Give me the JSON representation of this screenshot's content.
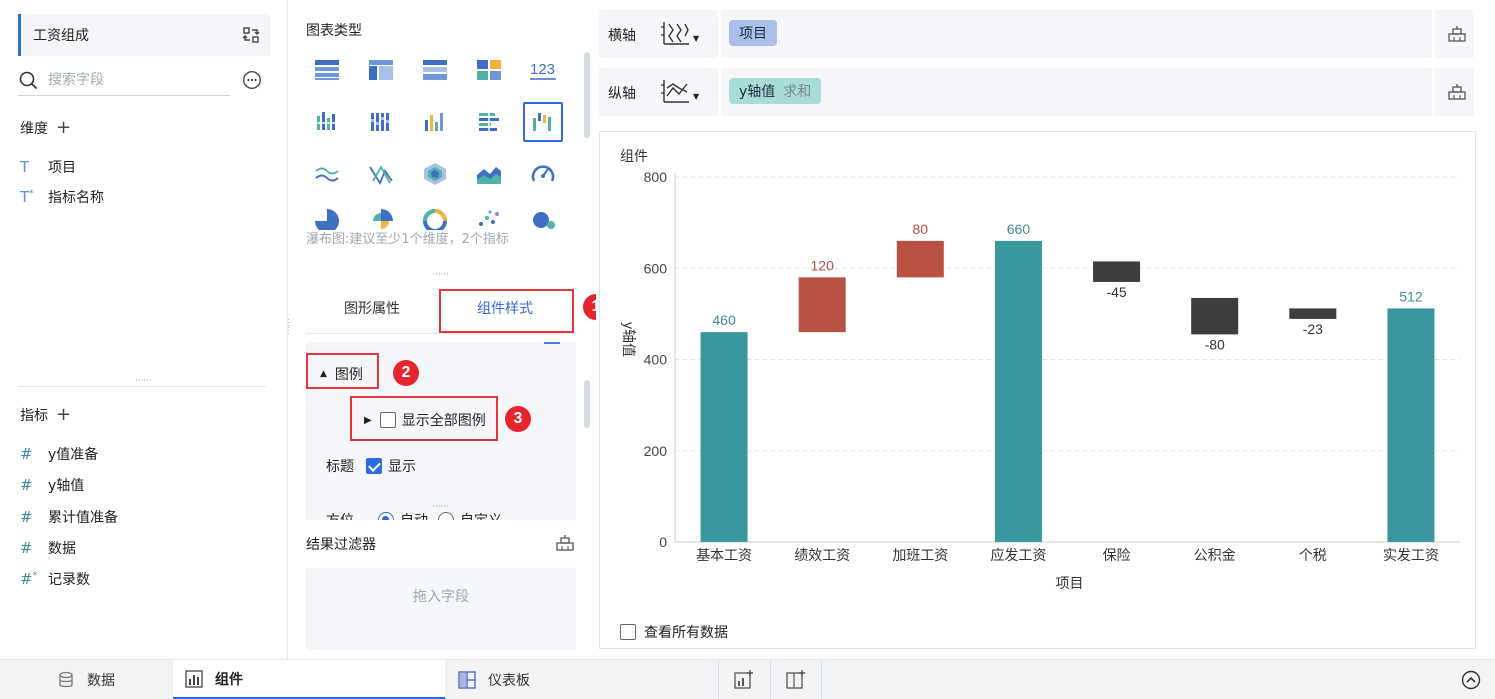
{
  "left": {
    "dataset_name": "工资组成",
    "search_placeholder": "搜索字段",
    "dimensions_label": "维度",
    "dimensions": [
      {
        "label": "项目",
        "icon": "text-icon"
      },
      {
        "label": "指标名称",
        "icon": "text-calc-icon"
      }
    ],
    "measures_label": "指标",
    "measures": [
      {
        "label": "y值准备",
        "icon": "hash-icon"
      },
      {
        "label": "y轴值",
        "icon": "hash-icon"
      },
      {
        "label": "累计值准备",
        "icon": "hash-icon"
      },
      {
        "label": "数据",
        "icon": "hash-icon"
      },
      {
        "label": "记录数",
        "icon": "hash-calc-icon"
      }
    ]
  },
  "middle": {
    "chart_type_title": "图表类型",
    "chart_type_hint": "瀑布图:建议至少1个维度，2个指标",
    "tabs": [
      "图形属性",
      "组件样式"
    ],
    "legend_label": "图例",
    "show_all_legend_label": "显示全部图例",
    "title_label": "标题",
    "title_show_label": "显示",
    "position_label": "方位",
    "position_auto": "自动",
    "position_custom": "自定义",
    "filter_title": "结果过滤器",
    "filter_placeholder": "拖入字段"
  },
  "annotations": [
    "1",
    "2",
    "3"
  ],
  "right": {
    "x_axis_label": "横轴",
    "x_axis_field": "项目",
    "y_axis_label": "纵轴",
    "y_axis_field": "y轴值",
    "y_axis_agg": "求和",
    "card_title": "组件",
    "view_all_label": "查看所有数据"
  },
  "chart_data": {
    "type": "bar",
    "subtype": "waterfall",
    "categories": [
      "基本工资",
      "绩效工资",
      "加班工资",
      "应发工资",
      "保险",
      "公积金",
      "个税",
      "实发工资"
    ],
    "values": [
      460,
      120,
      80,
      660,
      -45,
      -80,
      -23,
      512
    ],
    "bases": [
      0,
      460,
      580,
      0,
      615,
      535,
      512,
      0
    ],
    "value_labels": [
      "460",
      "120",
      "80",
      "660",
      "-45",
      "-80",
      "-23",
      "512"
    ],
    "colors": [
      "#3a979f",
      "#b85142",
      "#b85142",
      "#3a979f",
      "#3d3d3d",
      "#3d3d3d",
      "#3d3d3d",
      "#3a979f"
    ],
    "label_colors": [
      "#3a8e98",
      "#b85142",
      "#b85142",
      "#3a8e98",
      "#333333",
      "#333333",
      "#333333",
      "#3a8e98"
    ],
    "xlabel": "项目",
    "ylabel": "y轴值",
    "ylim": [
      0,
      800
    ],
    "yticks": [
      0,
      200,
      400,
      600,
      800
    ],
    "grid": true
  },
  "bottom": {
    "tabs": [
      "数据",
      "组件",
      "仪表板"
    ]
  }
}
